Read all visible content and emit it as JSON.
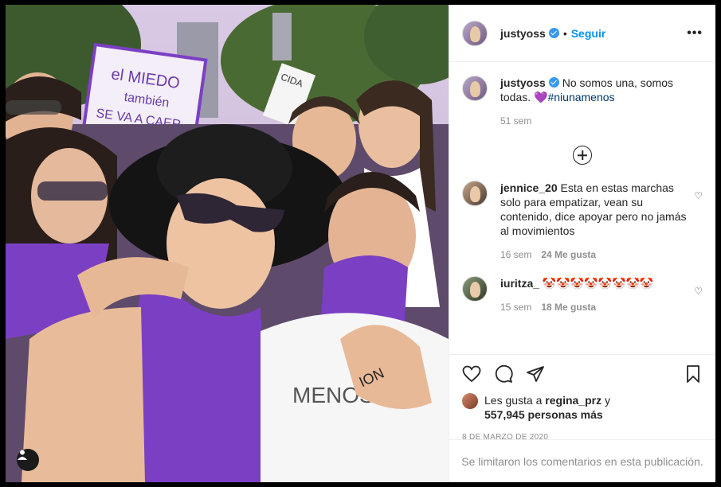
{
  "post": {
    "username": "justyoss",
    "separator": "•",
    "follow_label": "Seguir",
    "more_icon": "more-options-icon"
  },
  "photo": {
    "sign_text_line1": "el MIEDO",
    "sign_text_line2": "también",
    "sign_text_line3": "SE VA A CAER",
    "sign2_text": "CIDA",
    "shirt_text": "MENOS",
    "hand_text": "ION"
  },
  "caption": {
    "username": "justyoss",
    "text": "No somos una, somos todas.",
    "emoji": "💜",
    "hashtag": "#niunamenos",
    "time": "51 sem"
  },
  "comments": [
    {
      "username": "jennice_20",
      "text": "Esta en estas marchas solo para empatizar, vean su contenido, dice apoyar pero no jamás al movimientos",
      "time": "16 sem",
      "likes": "24 Me gusta"
    },
    {
      "username": "iuritza_",
      "text": "🤡🤡🤡🤡🤡🤡🤡🤡",
      "time": "15 sem",
      "likes": "18 Me gusta"
    }
  ],
  "likes_line": {
    "prefix": "Les gusta a",
    "user": "regina_prz",
    "mid": "y",
    "others": "557,945 personas más"
  },
  "date": "8 DE MARZO DE 2020",
  "comments_closed": "Se limitaron los comentarios en esta publicación.",
  "colors": {
    "accent": "#0095f6",
    "verified": "#3897f0",
    "purple": "#7b3fc4"
  }
}
